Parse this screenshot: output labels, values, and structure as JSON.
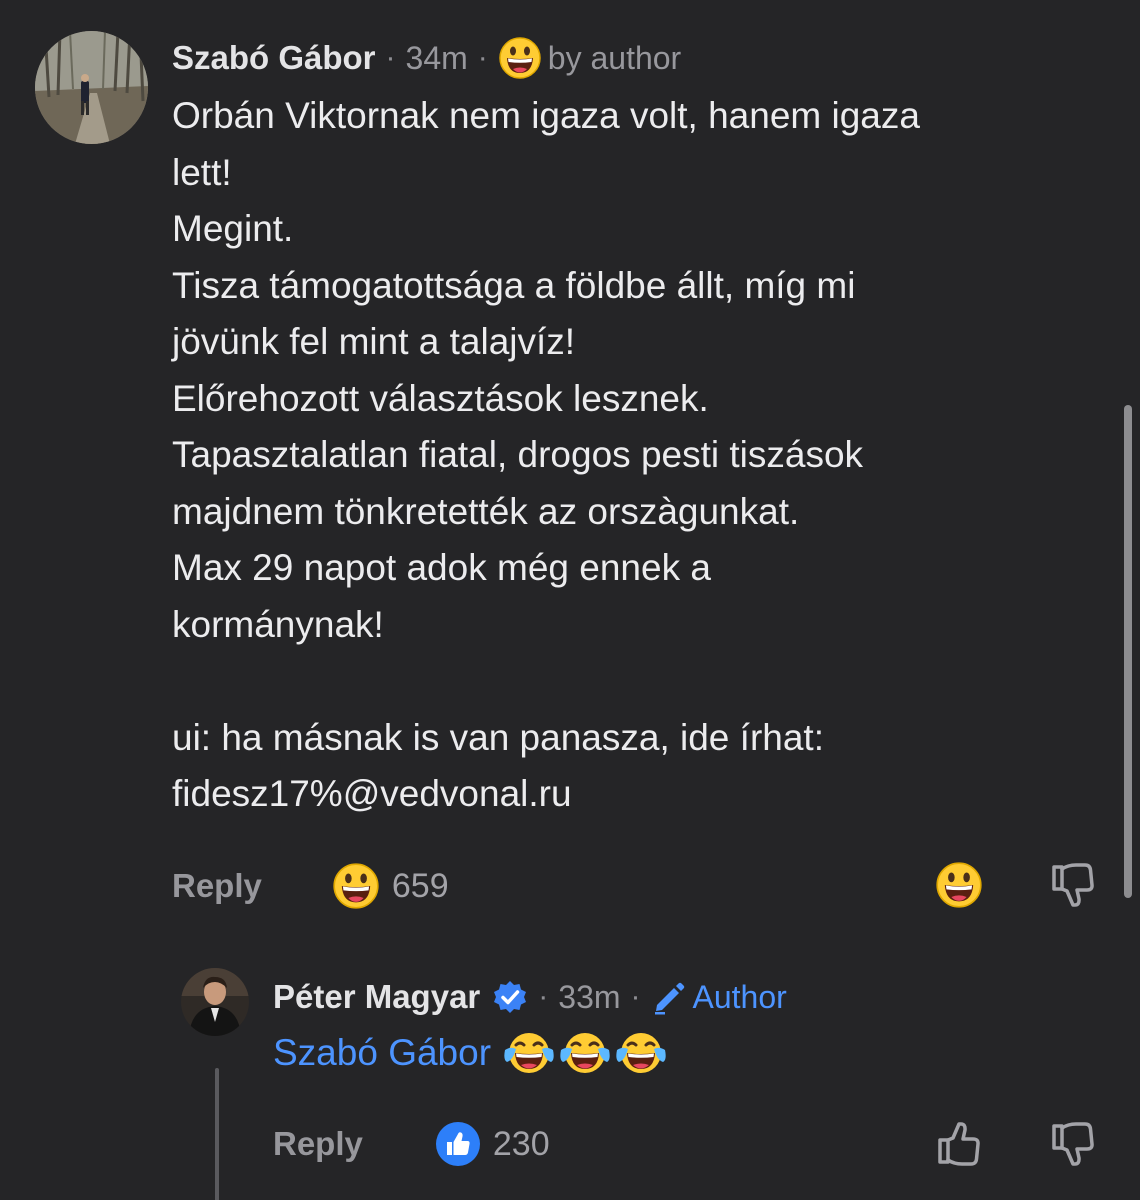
{
  "comment": {
    "author": "Szabó Gábor",
    "time": "34m",
    "author_badge": "by author",
    "lines": [
      "Orbán Viktornak nem igaza volt, hanem igaza",
      "lett!",
      "Megint.",
      "Tisza támogatottsága a földbe állt, míg mi",
      "jövünk fel mint a talajvíz!",
      "Előrehozott választások lesznek.",
      "Tapasztalatlan fiatal, drogos pesti tiszások",
      "majdnem tönkretették az orszàgunkat.",
      "Max 29 napot adok még ennek a",
      "kormánynak!",
      "",
      "ui: ha másnak is van panasza, ide írhat:",
      "fidesz17%@vedvonal.ru"
    ],
    "reply_label": "Reply",
    "reaction_icon": "grinning-face-icon",
    "reaction_count": "659"
  },
  "reply": {
    "author": "Péter Magyar",
    "verified_icon": "verified-badge-icon",
    "time": "33m",
    "author_badge": "Author",
    "mention": "Szabó Gábor",
    "emojis": [
      "tears-of-joy-icon",
      "tears-of-joy-icon",
      "tears-of-joy-icon"
    ],
    "reply_label": "Reply",
    "reaction_icon": "thumbs-up-icon",
    "reaction_count": "230"
  },
  "colors": {
    "background": "#252527",
    "text": "#ececee",
    "muted": "#98989d",
    "accent_blue": "#4d94ff"
  }
}
